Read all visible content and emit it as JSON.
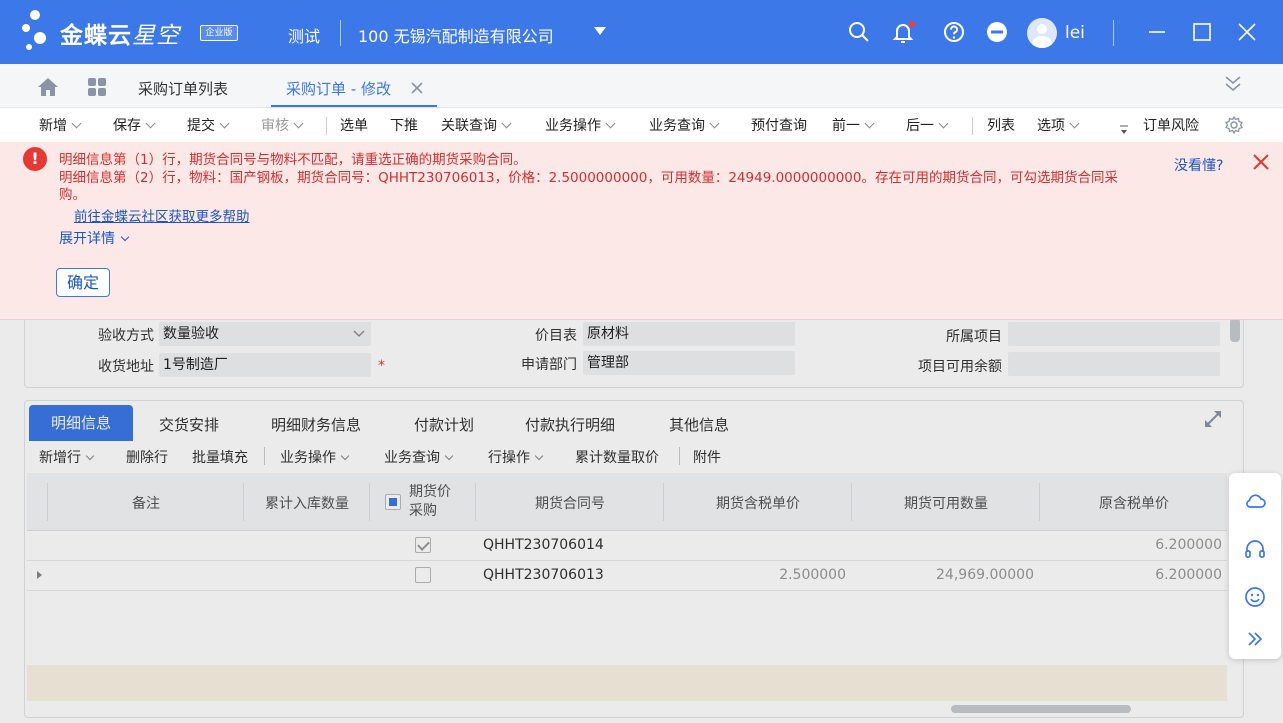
{
  "titlebar": {
    "brand_main": "金蝶云",
    "brand_sub": "星空",
    "edition": "企业版",
    "environment": "测试",
    "company": "100  无锡汽配制造有限公司",
    "username": "lei"
  },
  "tabs": {
    "list": "采购订单列表",
    "active": "采购订单 - 修改"
  },
  "toolbar": {
    "new": "新增",
    "save": "保存",
    "submit": "提交",
    "audit": "审核",
    "select_bill": "选单",
    "push_down": "下推",
    "linked_query": "关联查询",
    "biz_operation": "业务操作",
    "biz_query": "业务查询",
    "prepay_query": "预付查询",
    "prev": "前一",
    "next": "后一",
    "list": "列表",
    "options": "选项",
    "order_risk": "订单风险"
  },
  "error": {
    "line1": "明细信息第（1）行，期货合同号与物料不匹配，请重选正确的期货采购合同。",
    "line2": "明细信息第（2）行，物料：国产钢板，期货合同号：QHHT230706013，价格：2.5000000000，可用数量：24949.0000000000。存在可用的期货合同，可勾选期货合同采",
    "line3": "购。",
    "help_link": "前往金蝶云社区获取更多帮助",
    "expand": "展开详情",
    "ok": "确定",
    "not_understood": "没看懂?"
  },
  "form": {
    "accept_method_label": "验收方式",
    "accept_method_value": "数量验收",
    "ship_address_label": "收货地址",
    "ship_address_value": "1号制造厂",
    "required_mark": "*",
    "price_list_label": "价目表",
    "price_list_value": "原材料",
    "apply_dept_label": "申请部门",
    "apply_dept_value": "管理部",
    "project_label": "所属项目",
    "project_balance_label": "项目可用余额"
  },
  "detail": {
    "tabs": [
      "明细信息",
      "交货安排",
      "明细财务信息",
      "付款计划",
      "付款执行明细",
      "其他信息"
    ],
    "toolbar": {
      "add_row": "新增行",
      "delete_row": "删除行",
      "batch_fill": "批量填充",
      "biz_operation": "业务操作",
      "biz_query": "业务查询",
      "row_operation": "行操作",
      "cumulative_qty": "累计数量取价",
      "attachment": "附件"
    },
    "columns": {
      "remark": "备注",
      "cum_in_qty": "累计入库数量",
      "futures_purchase_1": "期货价",
      "futures_purchase_2": "采购",
      "futures_contract_no": "期货合同号",
      "futures_tax_price": "期货含税单价",
      "futures_avail_qty": "期货可用数量",
      "orig_tax_price": "原含税单价"
    },
    "rows": [
      {
        "checked": true,
        "contract": "QHHT230706014",
        "futures_price": "",
        "avail_qty": "",
        "orig_price": "6.200000"
      },
      {
        "checked": false,
        "contract": "QHHT230706013",
        "futures_price": "2.500000",
        "avail_qty": "24,969.00000",
        "orig_price": "6.200000"
      }
    ]
  }
}
